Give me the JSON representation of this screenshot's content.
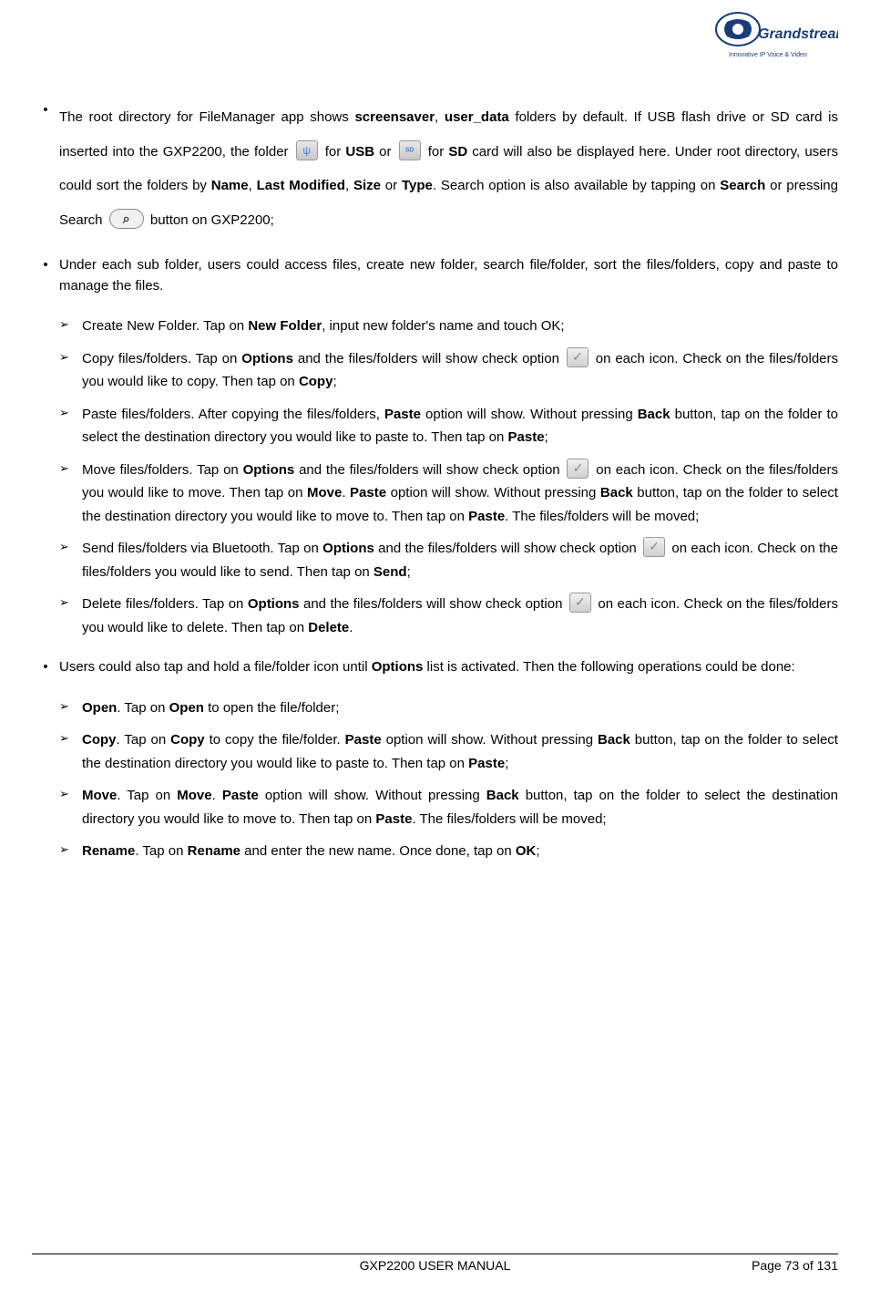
{
  "logo": {
    "brand": "Grandstream",
    "tagline": "Innovative IP Voice & Video"
  },
  "bullets": [
    {
      "parts": [
        {
          "t": "The root directory for FileManager app shows "
        },
        {
          "t": "screensaver",
          "bold": true
        },
        {
          "t": ", "
        },
        {
          "t": "user_data",
          "bold": true
        },
        {
          "t": " folders by default. If USB flash drive or SD card is inserted into the GXP2200, the folder "
        },
        {
          "icon": "usb"
        },
        {
          "t": " for "
        },
        {
          "t": "USB",
          "bold": true
        },
        {
          "t": " or "
        },
        {
          "icon": "sd"
        },
        {
          "t": " for "
        },
        {
          "t": "SD",
          "bold": true
        },
        {
          "t": " card will also be displayed here. Under root directory, users could sort the folders by "
        },
        {
          "t": "Name",
          "bold": true
        },
        {
          "t": ", "
        },
        {
          "t": "Last Modified",
          "bold": true
        },
        {
          "t": ", "
        },
        {
          "t": "Size",
          "bold": true
        },
        {
          "t": " or "
        },
        {
          "t": "Type",
          "bold": true
        },
        {
          "t": ". Search option is also available by tapping on "
        },
        {
          "t": "Search",
          "bold": true
        },
        {
          "t": " or pressing Search "
        },
        {
          "icon": "search"
        },
        {
          "t": " button on GXP2200;"
        }
      ],
      "spacing": "large"
    },
    {
      "parts": [
        {
          "t": "Under each sub folder, users could access files, create new folder, search file/folder, sort the files/folders, copy and paste to manage the files."
        }
      ],
      "sublist": [
        {
          "parts": [
            {
              "t": "Create New Folder. Tap on "
            },
            {
              "t": "New Folder",
              "bold": true
            },
            {
              "t": ", input new folder's name and touch OK;"
            }
          ]
        },
        {
          "parts": [
            {
              "t": "Copy files/folders. Tap on "
            },
            {
              "t": "Options",
              "bold": true
            },
            {
              "t": " and the files/folders will show check option "
            },
            {
              "icon": "check"
            },
            {
              "t": " on each icon. Check on the files/folders you would like to copy. Then tap on "
            },
            {
              "t": "Copy",
              "bold": true
            },
            {
              "t": ";"
            }
          ]
        },
        {
          "parts": [
            {
              "t": "Paste files/folders. After copying the files/folders, "
            },
            {
              "t": "Paste",
              "bold": true
            },
            {
              "t": " option will show. Without pressing "
            },
            {
              "t": "Back",
              "bold": true
            },
            {
              "t": " button, tap on the folder to select the destination directory you would like to paste to. Then tap on "
            },
            {
              "t": "Paste",
              "bold": true
            },
            {
              "t": ";"
            }
          ]
        },
        {
          "parts": [
            {
              "t": "Move files/folders. Tap on "
            },
            {
              "t": "Options",
              "bold": true
            },
            {
              "t": " and the files/folders will show check option "
            },
            {
              "icon": "check"
            },
            {
              "t": " on each icon. Check on the files/folders you would like to move. Then tap on "
            },
            {
              "t": "Move",
              "bold": true
            },
            {
              "t": ". "
            },
            {
              "t": "Paste",
              "bold": true
            },
            {
              "t": " option will show. Without pressing "
            },
            {
              "t": "Back",
              "bold": true
            },
            {
              "t": " button, tap on the folder to select the destination directory you would like to move to. Then tap on "
            },
            {
              "t": "Paste",
              "bold": true
            },
            {
              "t": ". The files/folders will be moved;"
            }
          ]
        },
        {
          "parts": [
            {
              "t": "Send files/folders via Bluetooth. Tap on "
            },
            {
              "t": "Options",
              "bold": true
            },
            {
              "t": " and the files/folders will show check option "
            },
            {
              "icon": "check"
            },
            {
              "t": " on each icon. Check on the files/folders you would like to send. Then tap on "
            },
            {
              "t": "Send",
              "bold": true
            },
            {
              "t": ";"
            }
          ]
        },
        {
          "parts": [
            {
              "t": "Delete files/folders. Tap on "
            },
            {
              "t": "Options",
              "bold": true
            },
            {
              "t": " and the files/folders will show check option "
            },
            {
              "icon": "check"
            },
            {
              "t": " on each icon. Check on the files/folders you would like to delete. Then tap on "
            },
            {
              "t": "Delete",
              "bold": true
            },
            {
              "t": "."
            }
          ]
        }
      ]
    },
    {
      "parts": [
        {
          "t": "Users could also tap and hold a file/folder icon until "
        },
        {
          "t": "Options",
          "bold": true
        },
        {
          "t": " list is activated. Then the following operations could be done:"
        }
      ],
      "sublist": [
        {
          "parts": [
            {
              "t": "Open",
              "bold": true
            },
            {
              "t": ". Tap on "
            },
            {
              "t": "Open",
              "bold": true
            },
            {
              "t": " to open the file/folder;"
            }
          ]
        },
        {
          "parts": [
            {
              "t": "Copy",
              "bold": true
            },
            {
              "t": ". Tap on "
            },
            {
              "t": "Copy",
              "bold": true
            },
            {
              "t": " to copy the file/folder. "
            },
            {
              "t": "Paste",
              "bold": true
            },
            {
              "t": " option will show. Without pressing "
            },
            {
              "t": "Back",
              "bold": true
            },
            {
              "t": " button, tap on the folder to select the destination directory you would like to paste to. Then tap on "
            },
            {
              "t": "Paste",
              "bold": true
            },
            {
              "t": ";"
            }
          ]
        },
        {
          "parts": [
            {
              "t": "Move",
              "bold": true
            },
            {
              "t": ". Tap on "
            },
            {
              "t": "Move",
              "bold": true
            },
            {
              "t": ". "
            },
            {
              "t": "Paste",
              "bold": true
            },
            {
              "t": " option will show. Without pressing "
            },
            {
              "t": "Back",
              "bold": true
            },
            {
              "t": " button, tap on the folder to select the destination directory you would like to move to. Then tap on "
            },
            {
              "t": "Paste",
              "bold": true
            },
            {
              "t": ". The files/folders will be moved;"
            }
          ]
        },
        {
          "parts": [
            {
              "t": "Rename",
              "bold": true
            },
            {
              "t": ". Tap on "
            },
            {
              "t": "Rename",
              "bold": true
            },
            {
              "t": " and enter the new name. Once done, tap on "
            },
            {
              "t": "OK",
              "bold": true
            },
            {
              "t": ";"
            }
          ]
        }
      ]
    }
  ],
  "footer": {
    "center": "GXP2200 USER MANUAL",
    "right": "Page 73 of 131"
  }
}
